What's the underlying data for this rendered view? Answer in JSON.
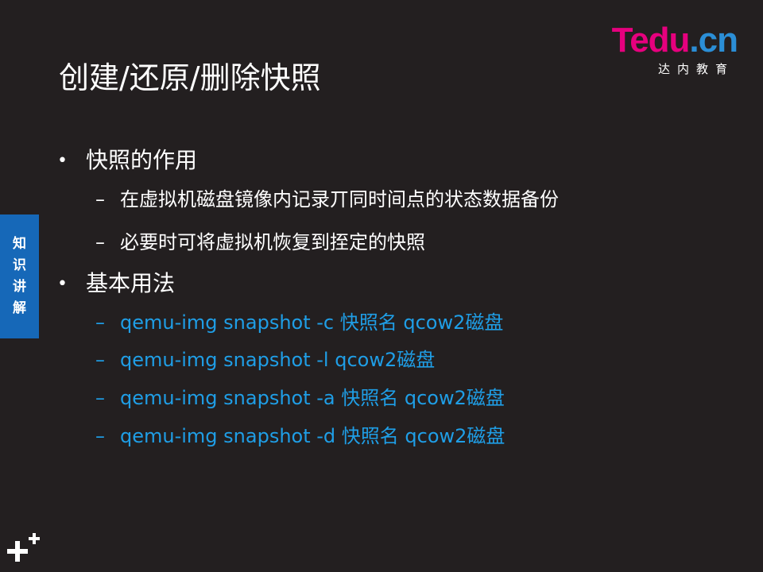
{
  "logo": {
    "brand": "Tedu",
    "suffix": ".cn",
    "tagline": "达内教育",
    "brand_color": "#e6007e",
    "suffix_color": "#2b8ed6"
  },
  "title": "创建/还原/删除快照",
  "side_tab": {
    "label": "知识讲解",
    "color": "#1668b8"
  },
  "sections": [
    {
      "bullet": "快照的作用",
      "items": [
        "在虚拟机磁盘镜像内记录丌同时间点的状态数据备份",
        "必要时可将虚拟机恢复到挃定的快照"
      ]
    },
    {
      "bullet": "基本用法",
      "items": [
        "qemu-img  snapshot -c  快照名  qcow2磁盘",
        "qemu-img  snapshot  -l  qcow2磁盘",
        "qemu-img  snapshot  -a  快照名  qcow2磁盘",
        "qemu-img  snapshot  -d  快照名  qcow2磁盘"
      ]
    }
  ],
  "colors": {
    "background": "#231f20",
    "text": "#ffffff",
    "code": "#1f9ee6"
  },
  "icons": {
    "bullet": "•",
    "dash": "–",
    "corner_mark": "plus-logo-icon"
  }
}
